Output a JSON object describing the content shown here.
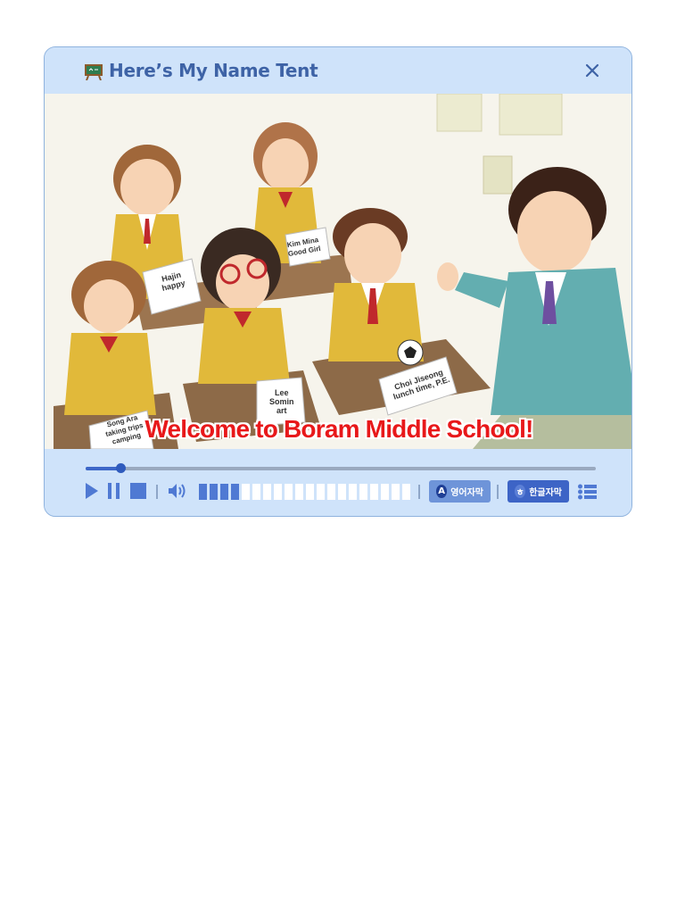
{
  "window": {
    "title": "Here’s My Name Tent",
    "title_icon": "chalkboard-icon",
    "close_icon": "close-icon"
  },
  "scene": {
    "caption": "Welcome to Boram Middle School!",
    "name_tents": [
      {
        "text": "Hajin\nhappy"
      },
      {
        "text": "Kim Mina\nGood Girl"
      },
      {
        "text": "Lee\nSomin\nart"
      },
      {
        "text": "Choi Jiseong\nlunch time, P.E."
      },
      {
        "text": "Song Ara\ntaking trips\ncamping"
      }
    ]
  },
  "player": {
    "progress": 0.068,
    "volume_level": 4,
    "volume_segments": 20,
    "play_icon": "play-icon",
    "pause_icon": "pause-icon",
    "stop_icon": "stop-icon",
    "volume_icon": "speaker-icon",
    "list_icon": "list-icon",
    "subtitle_en": {
      "badge": "A",
      "label": "영어자막"
    },
    "subtitle_ko": {
      "badge": "ㅎ",
      "label": "한글자막"
    },
    "colors": {
      "panel": "#cfe3fa",
      "accent": "#3d64c6",
      "caption": "#e8181a"
    }
  }
}
